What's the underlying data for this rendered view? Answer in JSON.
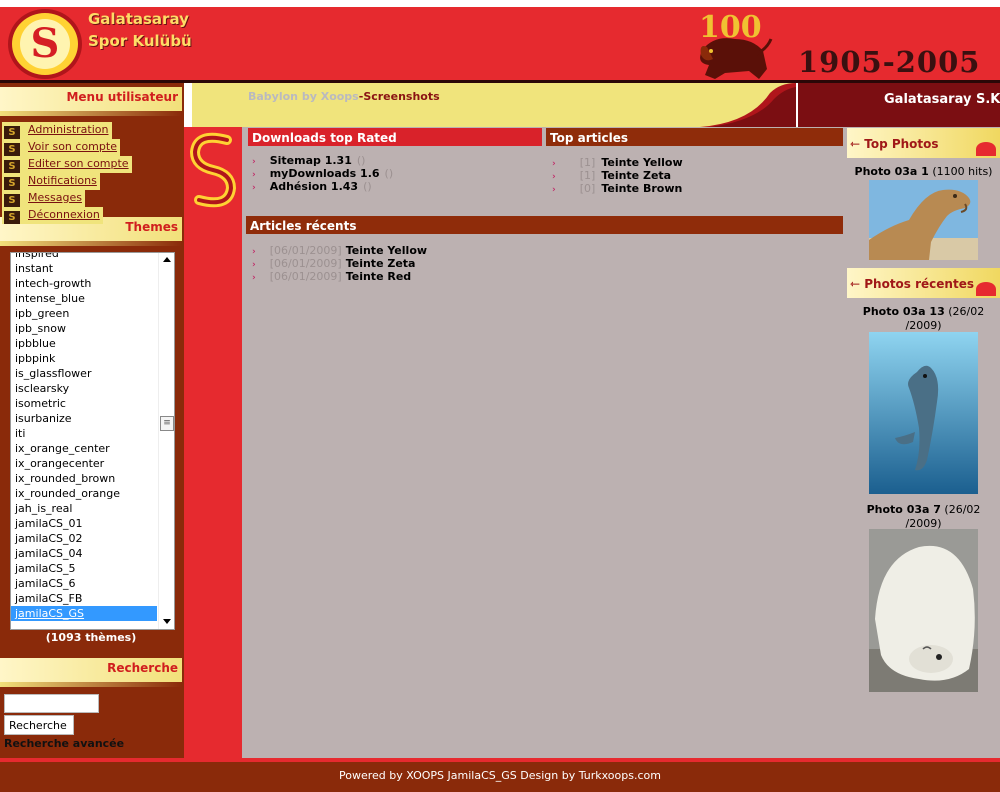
{
  "header": {
    "club_line1": "Galatasaray",
    "club_line2": "Spor Kulübü",
    "emblem_letter": "S",
    "anniversary": "100",
    "years": "1905-2005"
  },
  "navbar": {
    "breadcrumb_site": "Babylon by Xoops",
    "breadcrumb_sep": "-",
    "breadcrumb_page": "Screenshots",
    "site_name": "Galatasaray S.K"
  },
  "user_menu": {
    "title": "Menu utilisateur",
    "items": [
      {
        "label": "Administration",
        "icon": "galatasaray-s-icon"
      },
      {
        "label": "Voir son compte",
        "icon": "galatasaray-s-icon"
      },
      {
        "label": "Editer son compte",
        "icon": "galatasaray-s-icon"
      },
      {
        "label": "Notifications",
        "icon": "galatasaray-s-icon"
      },
      {
        "label": "Messages",
        "icon": "galatasaray-s-icon"
      },
      {
        "label": "Déconnexion",
        "icon": "galatasaray-s-icon"
      }
    ]
  },
  "themes": {
    "title": "Themes",
    "options": [
      "inspired",
      "instant",
      "intech-growth",
      "intense_blue",
      "ipb_green",
      "ipb_snow",
      "ipbblue",
      "ipbpink",
      "is_glassflower",
      "isclearsky",
      "isometric",
      "isurbanize",
      "iti",
      "ix_orange_center",
      "ix_orangecenter",
      "ix_rounded_brown",
      "ix_rounded_orange",
      "jah_is_real",
      "jamilaCS_01",
      "jamilaCS_02",
      "jamilaCS_04",
      "jamilaCS_5",
      "jamilaCS_6",
      "jamilaCS_FB",
      "jamilaCS_GS"
    ],
    "selected": "jamilaCS_GS",
    "count": "(1093 thèmes)"
  },
  "search": {
    "title": "Recherche",
    "input_value": "",
    "button_label": "Recherche",
    "advanced_label": "Recherche avancée"
  },
  "downloads_top": {
    "title": "Downloads top Rated",
    "items": [
      {
        "name": "Sitemap 1.31",
        "rating": "()"
      },
      {
        "name": "myDownloads 1.6",
        "rating": "()"
      },
      {
        "name": "Adhésion 1.43",
        "rating": "()"
      }
    ]
  },
  "top_articles": {
    "title": "Top articles",
    "items": [
      {
        "count": "[1]",
        "title": "Teinte Yellow"
      },
      {
        "count": "[1]",
        "title": "Teinte Zeta"
      },
      {
        "count": "[0]",
        "title": "Teinte Brown"
      }
    ]
  },
  "recent_articles": {
    "title": "Articles récents",
    "items": [
      {
        "date": "[06/01/2009]",
        "title": "Teinte Yellow"
      },
      {
        "date": "[06/01/2009]",
        "title": "Teinte Zeta"
      },
      {
        "date": "[06/01/2009]",
        "title": "Teinte Red"
      }
    ]
  },
  "top_photos": {
    "title": "Top Photos",
    "photo_name": "Photo 03a 1",
    "photo_meta": "(1100 hits)",
    "photo_subject": "camel"
  },
  "recent_photos": {
    "title": "Photos récentes",
    "photos": [
      {
        "name": "Photo 03a 13",
        "meta_line1": "(26/02",
        "meta_line2": "/2009)",
        "subject": "dolphin"
      },
      {
        "name": "Photo 03a 7",
        "meta_line1": "(26/02",
        "meta_line2": "/2009)",
        "subject": "polar-bear"
      }
    ]
  },
  "footer": {
    "text": "Powered by XOOPS JamilaCS_GS Design by Turkxoops.com"
  },
  "colors": {
    "primary_red": "#e62a2f",
    "dark_brown": "#8a2a0a",
    "cream_yellow": "#f0e47c",
    "content_grey": "#bcb1b1"
  }
}
